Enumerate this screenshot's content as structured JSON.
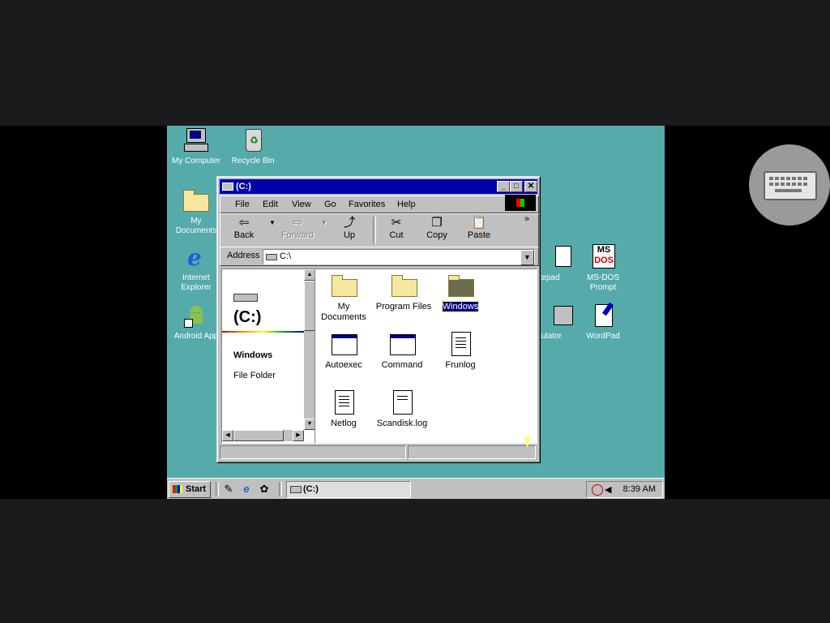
{
  "desktop": {
    "icons": [
      {
        "id": "my-computer",
        "label": "My Computer"
      },
      {
        "id": "recycle-bin",
        "label": "Recycle Bin"
      },
      {
        "id": "my-documents",
        "label1": "My",
        "label2": "Documents"
      },
      {
        "id": "internet-explorer",
        "label1": "Internet",
        "label2": "Explorer"
      },
      {
        "id": "android-app",
        "label": "Android App"
      },
      {
        "id": "notepad",
        "label": "tepad"
      },
      {
        "id": "ms-dos",
        "label1": "MS-DOS",
        "label2": "Prompt"
      },
      {
        "id": "calculator",
        "label": "culator"
      },
      {
        "id": "wordpad",
        "label": "WordPad"
      }
    ]
  },
  "window": {
    "title": "(C:)",
    "menu": [
      "File",
      "Edit",
      "View",
      "Go",
      "Favorites",
      "Help"
    ],
    "toolbar": {
      "back": "Back",
      "forward": "Forward",
      "up": "Up",
      "cut": "Cut",
      "copy": "Copy",
      "paste": "Paste",
      "more": "»"
    },
    "address": {
      "label": "Address",
      "value": "C:\\"
    },
    "left_pane": {
      "drive": "(C:)",
      "selected_name": "Windows",
      "selected_type": "File Folder"
    },
    "files": [
      {
        "label1": "My",
        "label2": "Documents",
        "kind": "folder-doc"
      },
      {
        "label": "Program Files",
        "kind": "folder"
      },
      {
        "label": "Windows",
        "kind": "folder-sel",
        "selected": true
      },
      {
        "label": "Autoexec",
        "kind": "app"
      },
      {
        "label": "Command",
        "kind": "app"
      },
      {
        "label": "Frunlog",
        "kind": "doc"
      },
      {
        "label": "Netlog",
        "kind": "doc"
      },
      {
        "label": "Scandisk.log",
        "kind": "doc"
      }
    ]
  },
  "taskbar": {
    "start": "Start",
    "task": "(C:)",
    "clock": "8:39 AM"
  },
  "colors": {
    "desktop": "#55aaaa",
    "titlebar": "#0000a8",
    "face": "#c0c0c0"
  },
  "overlay": {
    "keyboard": "keyboard-icon"
  }
}
